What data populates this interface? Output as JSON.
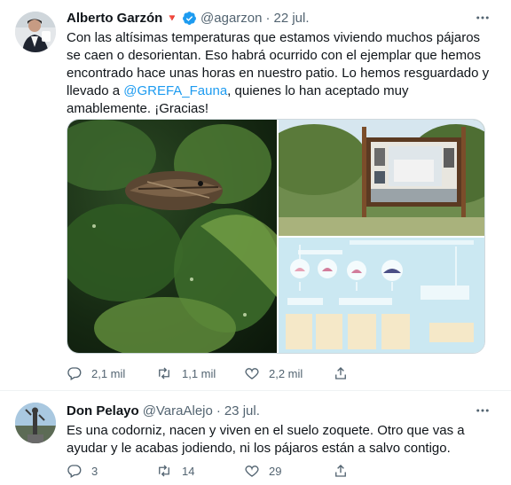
{
  "tweets": [
    {
      "name": "Alberto Garzón",
      "badge_symbol": "🔻",
      "verified": true,
      "handle": "@agarzon",
      "separator": "·",
      "date": "22 jul.",
      "text_before": "Con las altísimas temperaturas que estamos viviendo muchos pájaros se caen o desorientan. Eso habrá ocurrido con el ejemplar que hemos encontrado hace unas horas en nuestro patio. Lo hemos resguardado y llevado a ",
      "mention": "@GREFA_Fauna",
      "text_after": ", quienes lo han aceptado muy amablemente. ¡Gracias!",
      "media": [
        {
          "kind": "photo",
          "subject": "bird-among-leaves"
        },
        {
          "kind": "photo",
          "subject": "information-sign"
        },
        {
          "kind": "photo",
          "subject": "infographic"
        }
      ],
      "actions": {
        "replies": "2,1 mil",
        "retweets": "1,1 mil",
        "likes": "2,2 mil"
      }
    },
    {
      "name": "Don Pelayo",
      "handle": "@VaraAlejo",
      "separator": "·",
      "date": "23 jul.",
      "text": "Es una codorniz, nacen y viven en el suelo zoquete. Otro que vas a ayudar y le acabas jodiendo, ni los pájaros están a salvo contigo.",
      "actions": {
        "replies": "3",
        "retweets": "14",
        "likes": "29"
      }
    }
  ],
  "colors": {
    "accent": "#1d9bf0",
    "secondary_text": "#536471",
    "border": "#eff3f4"
  }
}
